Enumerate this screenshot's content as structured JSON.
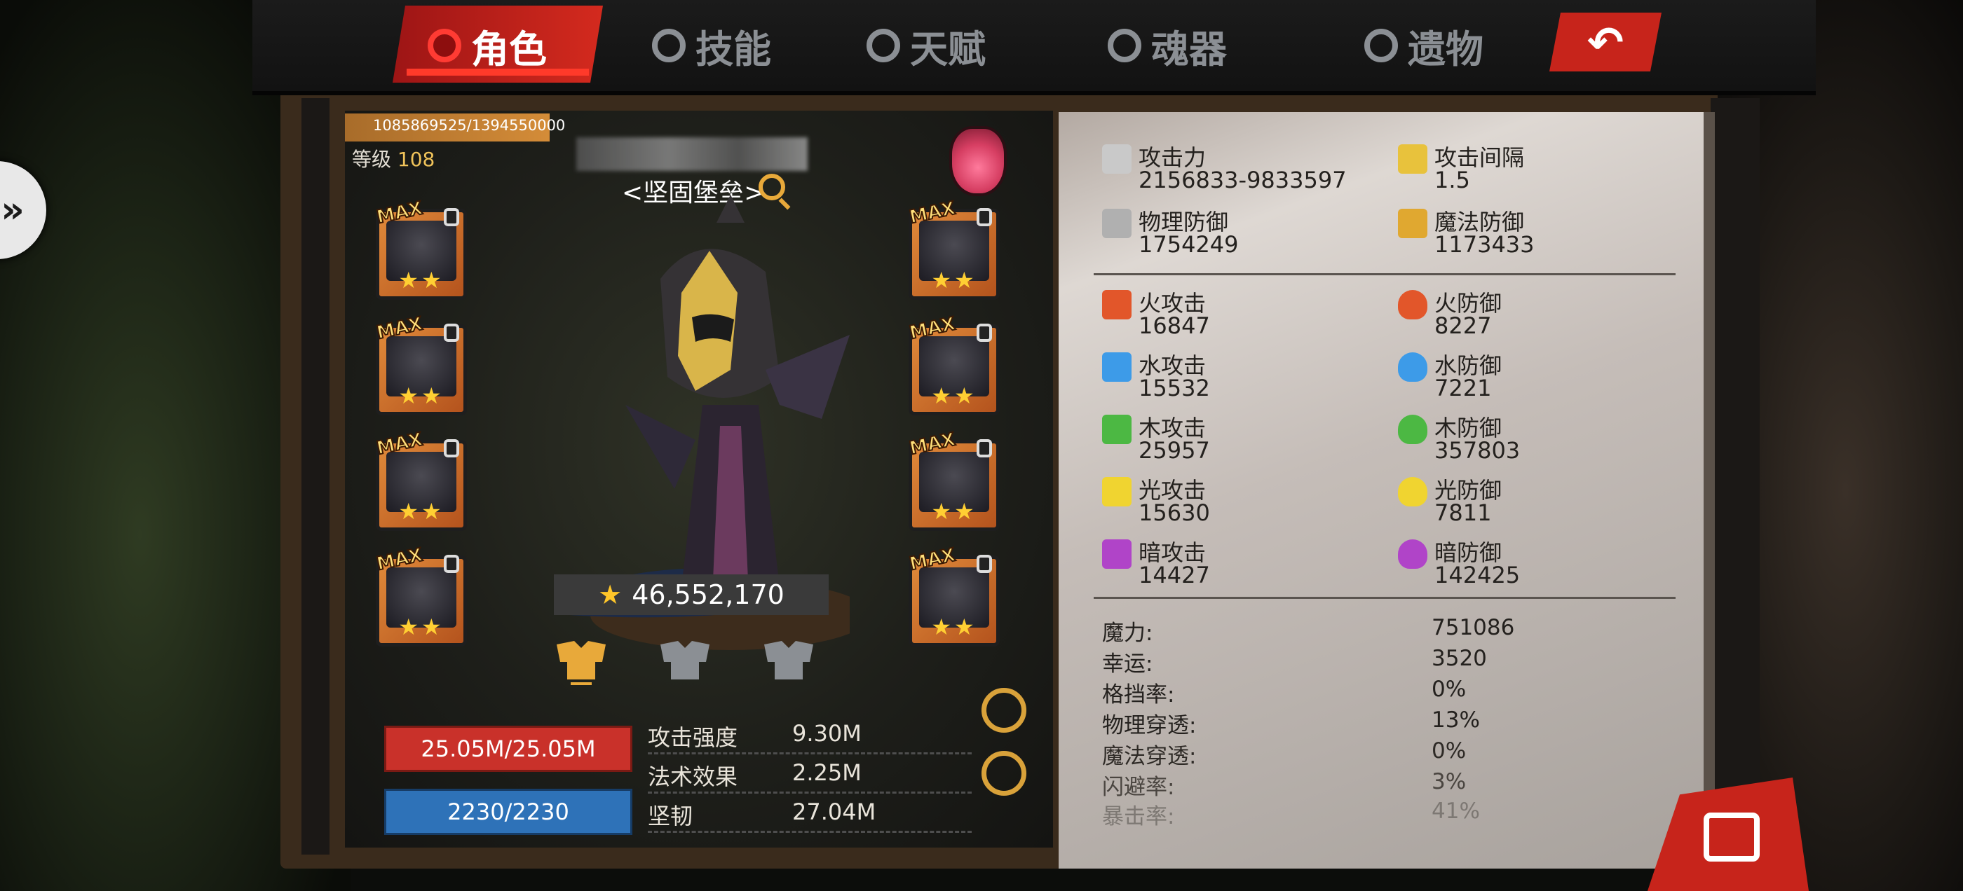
{
  "tabs": [
    {
      "label": "角色",
      "icon": "demon-mask-icon",
      "active": true
    },
    {
      "label": "技能",
      "icon": "swirl-icon",
      "active": false
    },
    {
      "label": "天赋",
      "icon": "crystal-icon",
      "active": false
    },
    {
      "label": "魂器",
      "icon": "soul-gem-icon",
      "active": false
    },
    {
      "label": "遗物",
      "icon": "flame-swirl-icon",
      "active": false
    }
  ],
  "header": {
    "back_icon": "back-arrow-icon"
  },
  "character": {
    "xp_text": "1085869525/1394550000",
    "level_label": "等级",
    "level_value": "108",
    "title": "<坚固堡垒>",
    "power": "46,552,170",
    "hp": "25.05M/25.05M",
    "mp": "2230/2230"
  },
  "equipment_left": [
    {
      "badge": "MAX",
      "stars": "★★"
    },
    {
      "badge": "MAX",
      "stars": "★★"
    },
    {
      "badge": "MAX",
      "stars": "★★"
    },
    {
      "badge": "MAX",
      "stars": "★★"
    }
  ],
  "equipment_right": [
    {
      "badge": "MAX",
      "stars": "★★"
    },
    {
      "badge": "MAX",
      "stars": "★★"
    },
    {
      "badge": "MAX",
      "stars": "★★"
    },
    {
      "badge": "MAX",
      "stars": "★★"
    }
  ],
  "summary_stats": [
    {
      "label": "攻击强度",
      "value": "9.30M"
    },
    {
      "label": "法术效果",
      "value": "2.25M"
    },
    {
      "label": "坚韧",
      "value": "27.04M"
    }
  ],
  "primary_stats": [
    {
      "label": "攻击力",
      "value": "2156833-9833597",
      "icon": "sword-icon",
      "color": "#c9c9c9"
    },
    {
      "label": "攻击间隔",
      "value": "1.5",
      "icon": "golden-sword-icon",
      "color": "#e8c23c"
    },
    {
      "label": "物理防御",
      "value": "1754249",
      "icon": "shield-sword-icon",
      "color": "#b0b0b0"
    },
    {
      "label": "魔法防御",
      "value": "1173433",
      "icon": "magic-shield-icon",
      "color": "#e0a830"
    }
  ],
  "element_attack": [
    {
      "label": "火攻击",
      "value": "16847",
      "icon": "fire-attack-icon",
      "color": "#e2562a"
    },
    {
      "label": "水攻击",
      "value": "15532",
      "icon": "water-attack-icon",
      "color": "#3d9be8"
    },
    {
      "label": "木攻击",
      "value": "25957",
      "icon": "wood-attack-icon",
      "color": "#4cb843"
    },
    {
      "label": "光攻击",
      "value": "15630",
      "icon": "light-attack-icon",
      "color": "#f0d430"
    },
    {
      "label": "暗攻击",
      "value": "14427",
      "icon": "dark-attack-icon",
      "color": "#b044c8"
    }
  ],
  "element_defense": [
    {
      "label": "火防御",
      "value": "8227",
      "icon": "fire-defense-icon",
      "color": "#e2562a"
    },
    {
      "label": "水防御",
      "value": "7221",
      "icon": "water-defense-icon",
      "color": "#3d9be8"
    },
    {
      "label": "木防御",
      "value": "357803",
      "icon": "wood-defense-icon",
      "color": "#4cb843"
    },
    {
      "label": "光防御",
      "value": "7811",
      "icon": "light-defense-icon",
      "color": "#f0d430"
    },
    {
      "label": "暗防御",
      "value": "142425",
      "icon": "dark-defense-icon",
      "color": "#b044c8"
    }
  ],
  "misc_stats": [
    {
      "label": "魔力:",
      "value": "751086"
    },
    {
      "label": "幸运:",
      "value": "3520"
    },
    {
      "label": "格挡率:",
      "value": "0%"
    },
    {
      "label": "物理穿透:",
      "value": "13%"
    },
    {
      "label": "魔法穿透:",
      "value": "0%"
    },
    {
      "label": "闪避率:",
      "value": "3%"
    },
    {
      "label": "暴击率:",
      "value": "41%"
    }
  ]
}
